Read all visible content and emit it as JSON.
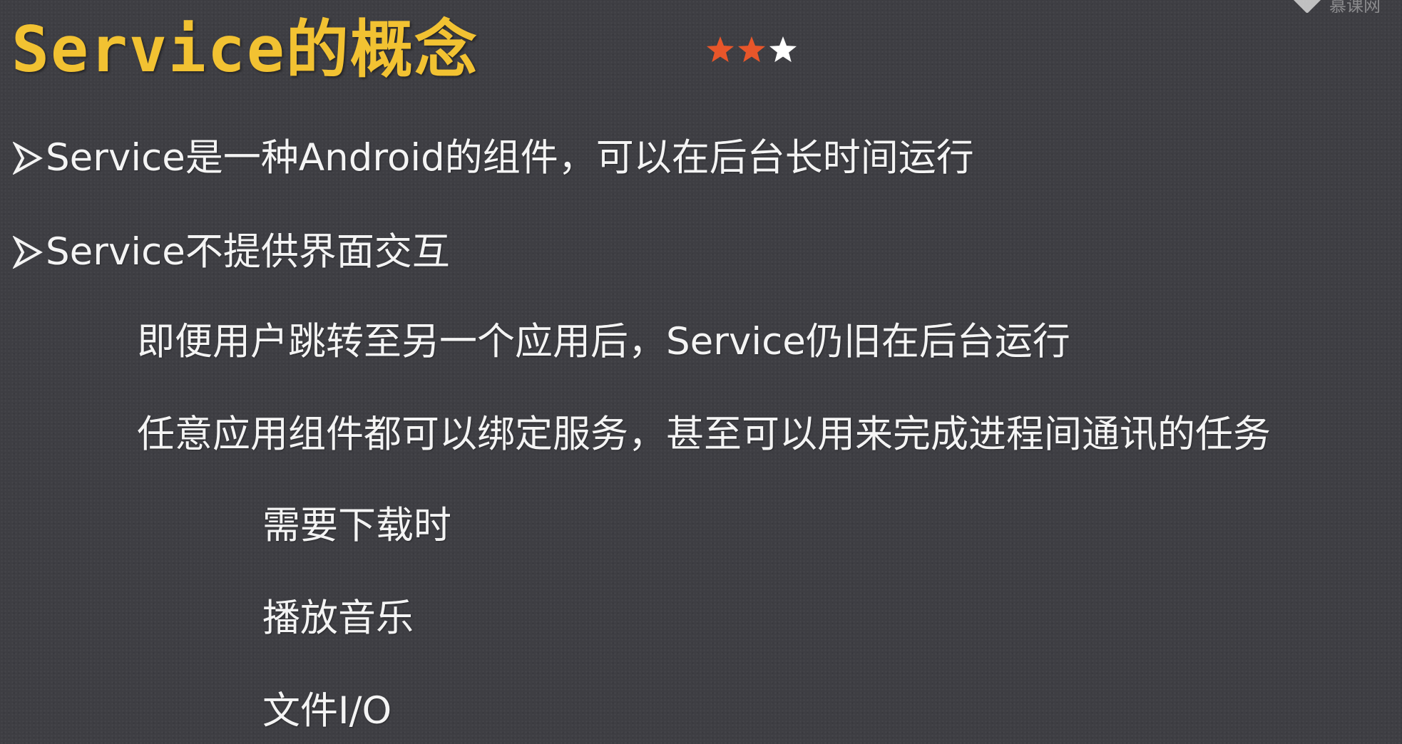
{
  "slide": {
    "title": "Service的概念",
    "rating": {
      "filled": 2,
      "total": 3,
      "filled_color": "#e8562a",
      "empty_color": "#ffffff"
    },
    "corner_watermark": "慕课网",
    "bullets": [
      {
        "text": "Service是一种Android的组件，可以在后台长时间运行",
        "bullet_icon": "arrow-bullet-icon"
      },
      {
        "text": "Service不提供界面交互",
        "bullet_icon": "arrow-bullet-icon"
      }
    ],
    "sub_points": [
      "即便用户跳转至另一个应用后，Service仍旧在后台运行",
      "任意应用组件都可以绑定服务，甚至可以用来完成进程间通讯的任务"
    ],
    "examples": [
      "需要下载时",
      "播放音乐",
      "文件I/O"
    ]
  },
  "colors": {
    "background": "#3e3e43",
    "title": "#f2c232",
    "text": "#f4f4f4"
  }
}
